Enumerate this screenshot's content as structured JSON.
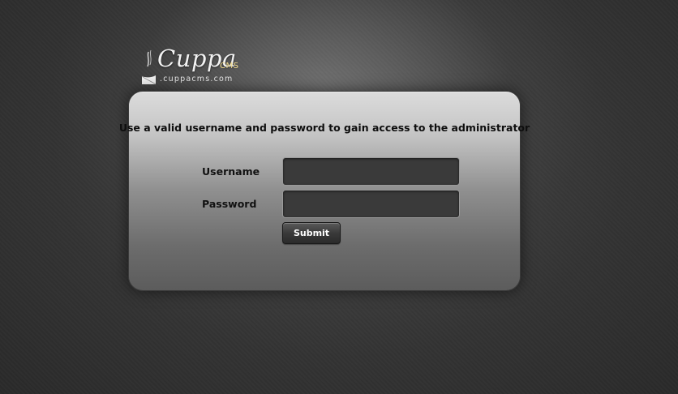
{
  "logo": {
    "wordmark": "Cuppa",
    "suffix": "CMS",
    "domain": ".cuppacms.com"
  },
  "login": {
    "message": "Use a valid username and password to gain access to the administrator",
    "username_label": "Username",
    "password_label": "Password",
    "username_value": "",
    "password_value": "",
    "submit_label": "Submit"
  },
  "colors": {
    "background": "#333333",
    "panel_top": "#dcdcdc",
    "panel_bottom": "#5c5c5c",
    "input_bg": "#3a3a3a",
    "logo_accent": "#f0d98a"
  }
}
